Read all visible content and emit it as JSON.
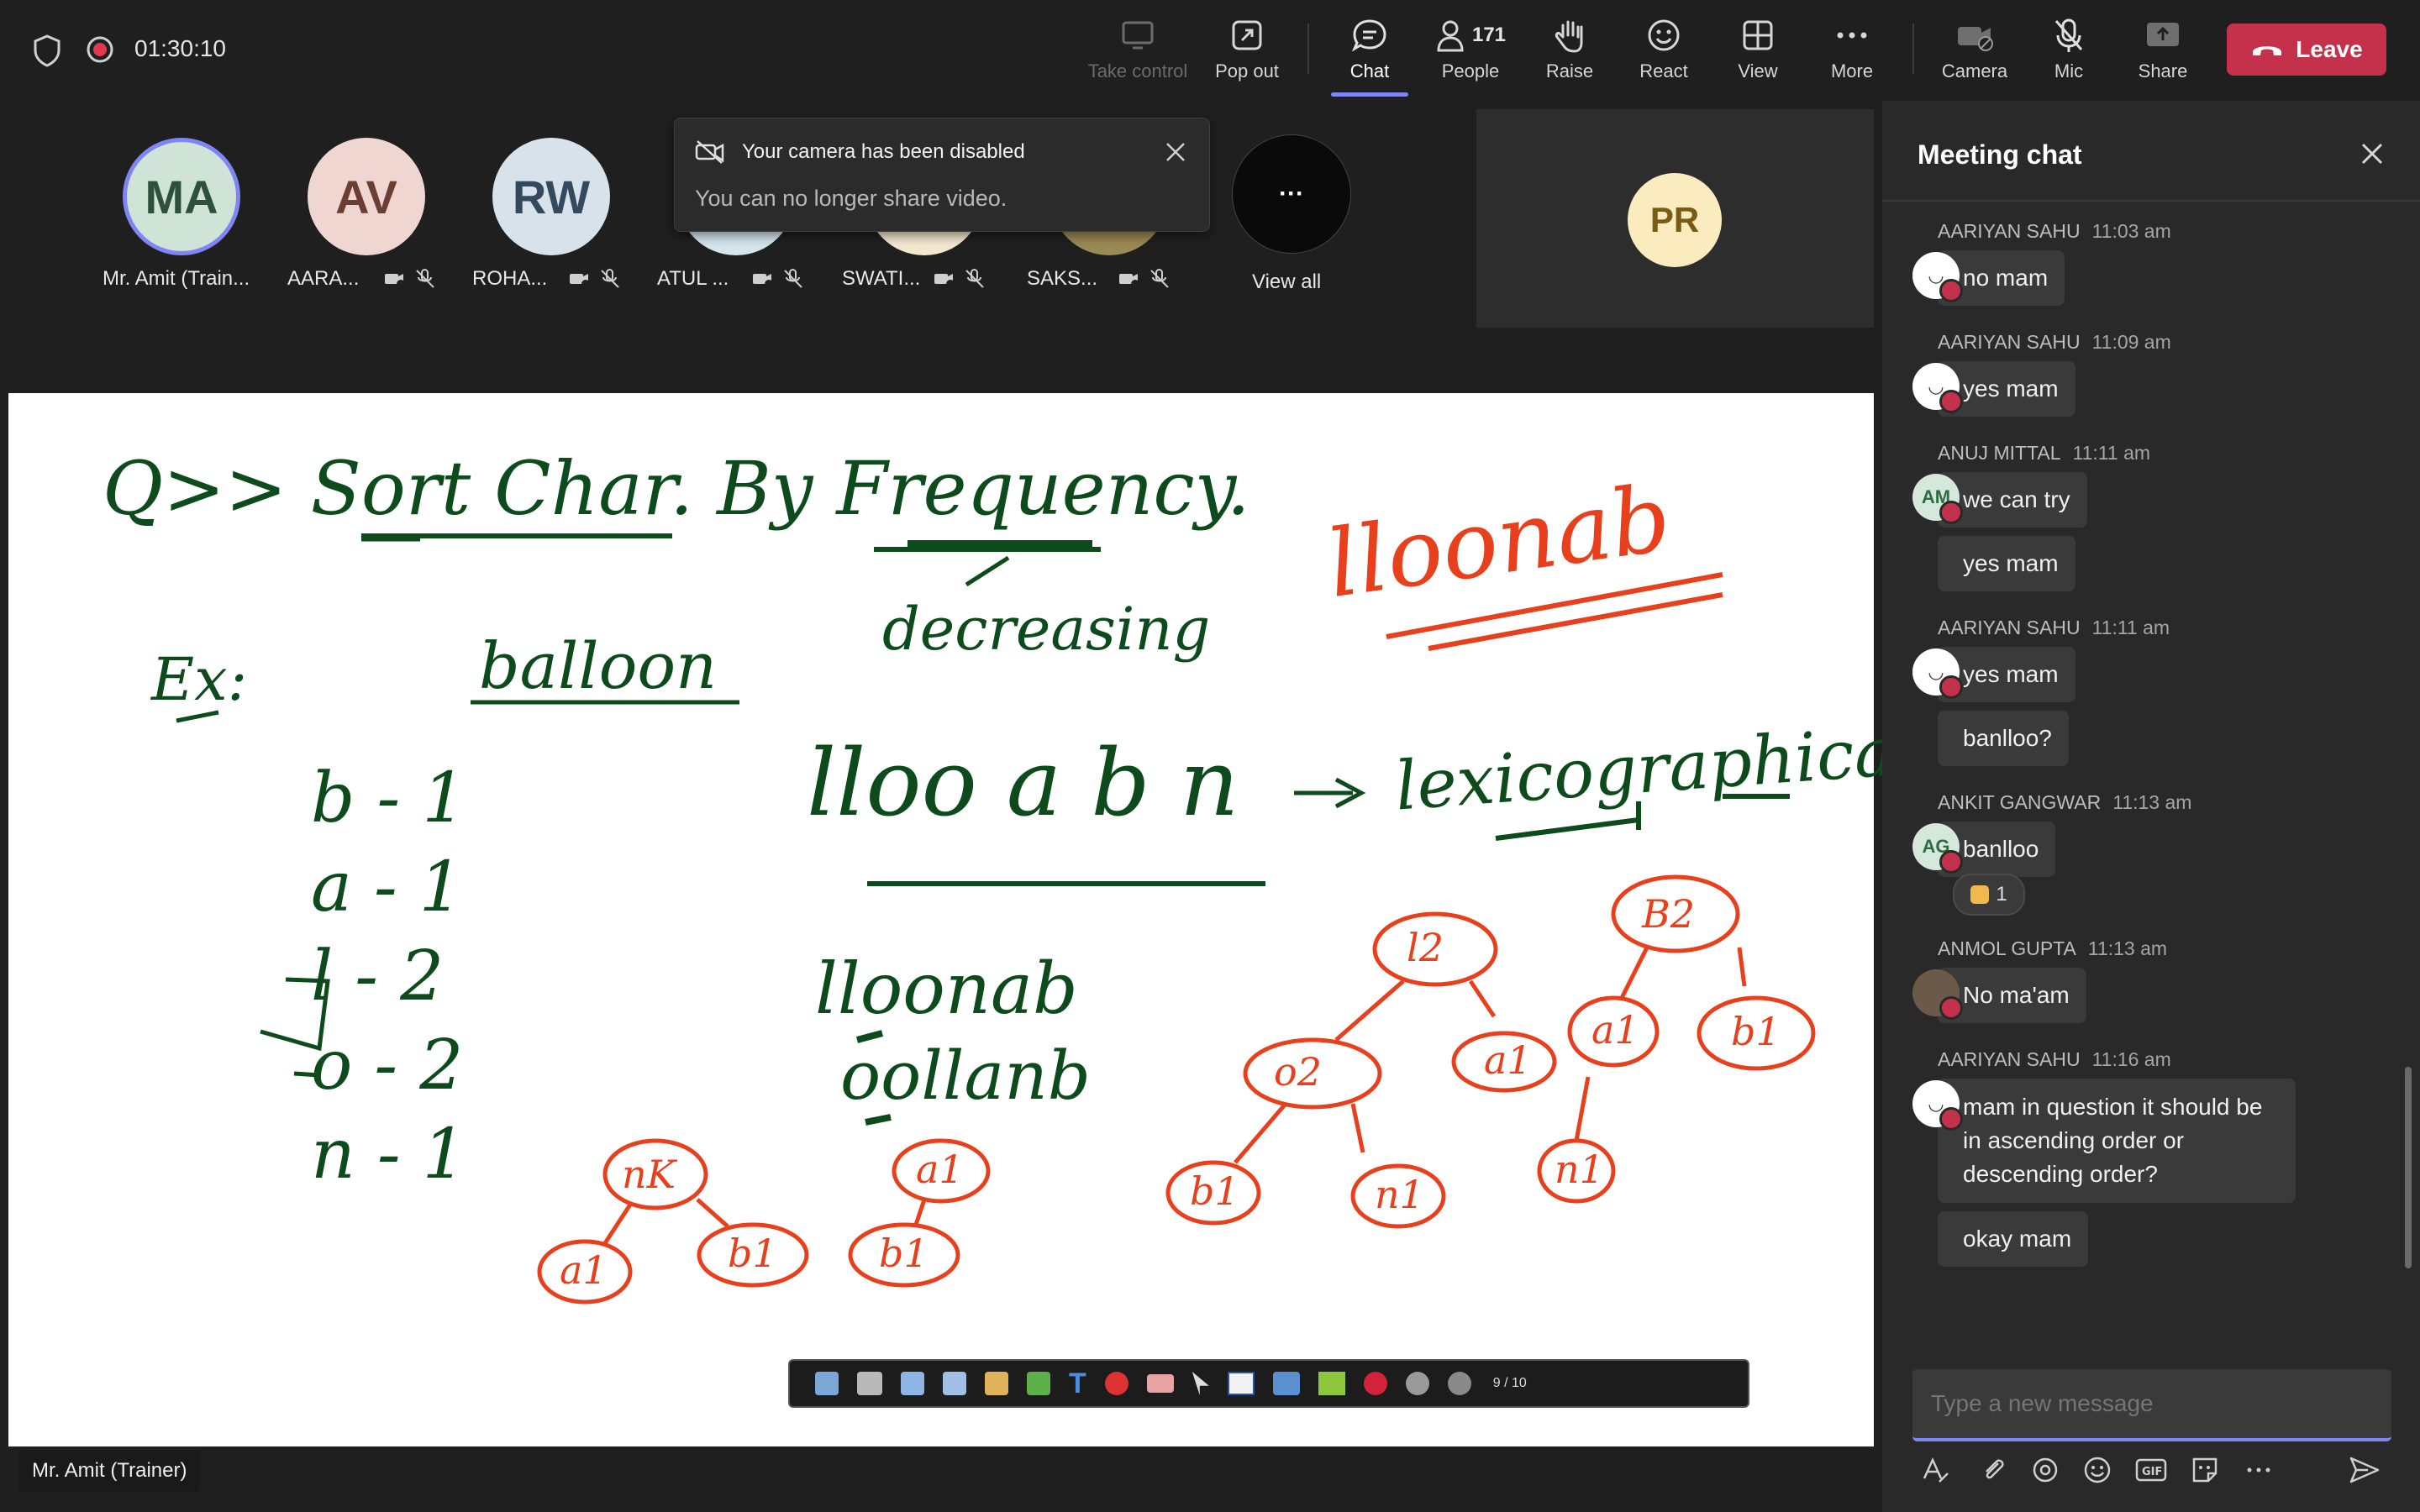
{
  "topbar": {
    "timer": "01:30:10",
    "buttons": {
      "take_control": "Take control",
      "pop_out": "Pop out",
      "chat": "Chat",
      "people": "People",
      "people_count": "171",
      "raise": "Raise",
      "react": "React",
      "view": "View",
      "more": "More",
      "camera": "Camera",
      "mic": "Mic",
      "share": "Share",
      "leave": "Leave"
    }
  },
  "participants": [
    {
      "initials": "MA",
      "name": "Mr. Amit (Train...",
      "color": "#cfe3d6",
      "text_color": "#2f4f3f"
    },
    {
      "initials": "AV",
      "name": "AARA...",
      "color": "#f0d6d1",
      "text_color": "#6a3e33"
    },
    {
      "initials": "RW",
      "name": "ROHA...",
      "color": "#d7e2ea",
      "text_color": "#34495e"
    },
    {
      "name": "ATUL ..."
    },
    {
      "name": "SWATI..."
    },
    {
      "name": "SAKS..."
    }
  ],
  "view_all": {
    "label": "View all",
    "dots": "···"
  },
  "toast": {
    "title": "Your camera has been disabled",
    "body": "You can no longer share video."
  },
  "pr_tile": {
    "initials": "PR"
  },
  "board": {
    "question": "Q>> Sort Char. By Frequency.",
    "ex": "Ex:",
    "word": "balloon",
    "decreasing": "decreasing",
    "answer_red": "lloonab",
    "counts": [
      "b - 1",
      "a - 1",
      "l - 2",
      "o - 2",
      "n - 1"
    ],
    "line1": "lloo a b n",
    "arrow_text": "lexicographical",
    "line2": "lloonab",
    "line3": "oollanb",
    "toolbar_page": "9 / 10"
  },
  "trainer_label": "Mr. Amit (Trainer)",
  "chat": {
    "title": "Meeting chat",
    "messages": [
      {
        "sender": "AARIYAN SAHU",
        "time": "11:03 am",
        "avatar": "",
        "bubbles": [
          "no mam"
        ]
      },
      {
        "sender": "AARIYAN SAHU",
        "time": "11:09 am",
        "avatar": "",
        "bubbles": [
          "yes mam"
        ]
      },
      {
        "sender": "ANUJ MITTAL",
        "time": "11:11 am",
        "avatar": "AM",
        "bubbles": [
          "we can try",
          "yes mam"
        ]
      },
      {
        "sender": "AARIYAN SAHU",
        "time": "11:11 am",
        "avatar": "",
        "bubbles": [
          "yes mam",
          "banlloo?"
        ]
      },
      {
        "sender": "ANKIT GANGWAR",
        "time": "11:13 am",
        "avatar": "AG",
        "bubbles": [
          "banlloo"
        ],
        "reaction": "1"
      },
      {
        "sender": "ANMOL GUPTA",
        "time": "11:13 am",
        "avatar": "",
        "bubbles": [
          "No ma'am"
        ]
      },
      {
        "sender": "AARIYAN SAHU",
        "time": "11:16 am",
        "avatar": "",
        "bubbles": [
          "mam in question it should be",
          "in ascending order or",
          "descending order?",
          "okay mam"
        ]
      }
    ],
    "composer_placeholder": "Type a new message"
  },
  "colors": {
    "accent": "#7f85f5",
    "leave": "#c4314b",
    "ink_green": "#0d4a1c",
    "ink_red": "#e8401c"
  }
}
